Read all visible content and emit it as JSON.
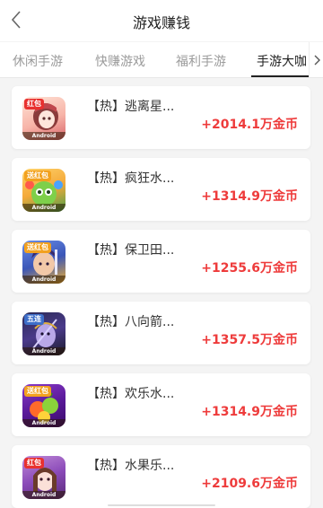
{
  "header": {
    "title": "游戏赚钱"
  },
  "tabs": [
    {
      "label": "休闲手游"
    },
    {
      "label": "快赚游戏"
    },
    {
      "label": "福利手游"
    },
    {
      "label": "手游大咖"
    }
  ],
  "active_tab": "手游大咖",
  "games": [
    {
      "name": "【热】逃离星...",
      "reward": "+2014.1万金币",
      "icon_badge": "红包",
      "icon_caption": "Android"
    },
    {
      "name": "【热】疯狂水...",
      "reward": "+1314.9万金币",
      "icon_badge": "送红包",
      "icon_caption": "Android"
    },
    {
      "name": "【热】保卫田...",
      "reward": "+1255.6万金币",
      "icon_badge": "送红包",
      "icon_caption": "Android"
    },
    {
      "name": "【热】八向箭...",
      "reward": "+1357.5万金币",
      "icon_badge": "五连",
      "icon_caption": "Android"
    },
    {
      "name": "【热】欢乐水...",
      "reward": "+1314.9万金币",
      "icon_badge": "送红包",
      "icon_caption": "Android"
    },
    {
      "name": "【热】水果乐...",
      "reward": "+2109.6万金币",
      "icon_badge": "红包",
      "icon_caption": "Android"
    }
  ],
  "colors": {
    "reward": "#ee3b3b",
    "active_tab": "#222222",
    "inactive_tab": "#9b9b9b",
    "background": "#f4f4f4"
  }
}
